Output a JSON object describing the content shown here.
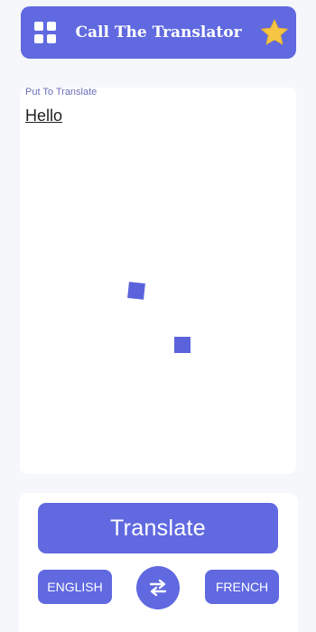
{
  "header": {
    "title": "Call The Translator",
    "menu_icon": "grid-icon",
    "favorite_icon": "star-icon"
  },
  "input": {
    "label": "Put To Translate",
    "text": "Hello"
  },
  "actions": {
    "translate_label": "Translate",
    "source_language": "ENGLISH",
    "target_language": "FRENCH",
    "swap_icon": "swap-arrows-icon"
  },
  "colors": {
    "accent": "#6069e0",
    "background": "#f6f7fb",
    "star": "#f6c543"
  }
}
